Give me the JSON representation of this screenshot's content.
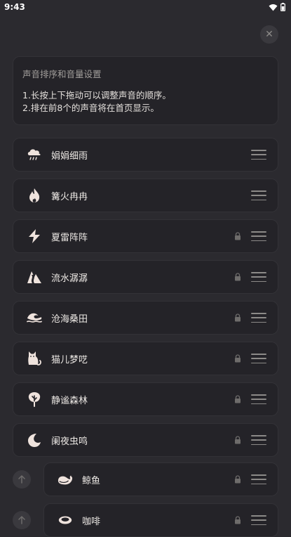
{
  "status_bar": {
    "time": "9:43"
  },
  "close_label": "✕",
  "info": {
    "title": "声音排序和音量设置",
    "line1": "1.长按上下拖动可以调整声音的顺序。",
    "line2": "2.排在前8个的声音将在首页显示。"
  },
  "sounds": [
    {
      "name": "娟娟细雨",
      "icon": "rain-cloud-icon",
      "locked": false
    },
    {
      "name": "篝火冉冉",
      "icon": "fire-icon",
      "locked": false
    },
    {
      "name": "夏雷阵阵",
      "icon": "lightning-icon",
      "locked": true
    },
    {
      "name": "流水潺潺",
      "icon": "stream-icon",
      "locked": true
    },
    {
      "name": "沧海桑田",
      "icon": "wave-icon",
      "locked": true
    },
    {
      "name": "猫儿梦呓",
      "icon": "cat-icon",
      "locked": true
    },
    {
      "name": "静谧森林",
      "icon": "tree-icon",
      "locked": true
    },
    {
      "name": "阑夜虫鸣",
      "icon": "moon-icon",
      "locked": true
    },
    {
      "name": "鲸鱼",
      "icon": "whale-icon",
      "locked": true
    },
    {
      "name": "咖啡",
      "icon": "coffee-icon",
      "locked": true
    }
  ],
  "colors": {
    "background": "#2b2a2f",
    "card": "#242328",
    "icon": "#efe3dd",
    "text": "#ece8e4",
    "muted": "#a29f9c"
  }
}
